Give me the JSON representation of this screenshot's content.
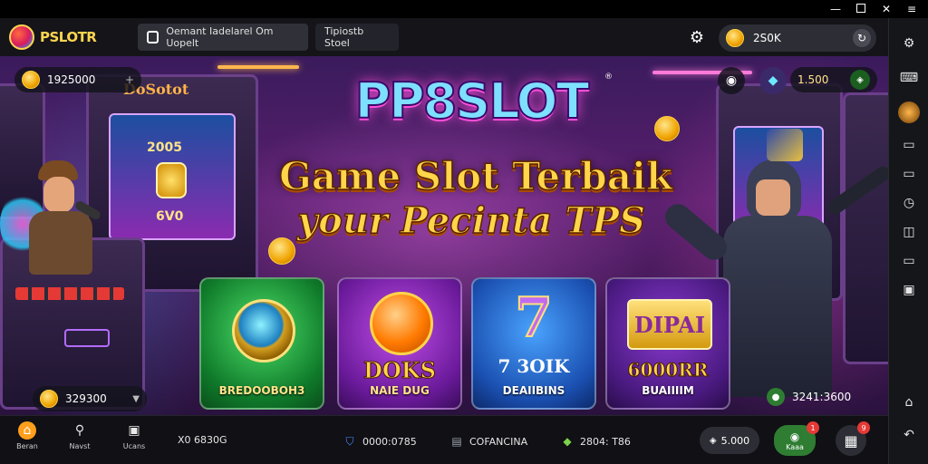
{
  "window": {
    "minimize": "—",
    "restore": "❐",
    "close": "✕"
  },
  "app": {
    "logo_text": "PSLOTR"
  },
  "tabs": [
    {
      "label": "Oemant Iadelarel Om Uopelt"
    },
    {
      "label": "Tipiostb Stoel"
    }
  ],
  "header": {
    "balance": "2S0K"
  },
  "banner": {
    "brand": "PP8SLOT",
    "reg_mark": "®",
    "headline_1": "Game Slot Terbaik",
    "headline_2": "your Pecinta TPS",
    "top_left_chip": "1925000",
    "bottom_left_chip": "329300",
    "right_chip": "1.500",
    "bottom_right_text": "3241:3600",
    "marquee": "DoSotot",
    "left_machine_text": "2005",
    "left_machine_text2": "6V0",
    "cards": [
      {
        "name": "Emerald Shield",
        "big": "",
        "label": "BREDOOBOH3"
      },
      {
        "name": "Orange Orb",
        "big": "DOKS",
        "label": "NAIE DUG"
      },
      {
        "name": "Golden Seven",
        "big": "7 3OIK",
        "label": "DEAIIBINS"
      },
      {
        "name": "Dipai Gold",
        "big": "6000RR",
        "label": "BUAIIIIM"
      }
    ]
  },
  "bottom_nav": {
    "items": [
      {
        "label": "Beran",
        "icon": "home-icon"
      },
      {
        "label": "Navst",
        "icon": "search-icon"
      },
      {
        "label": "Ucans",
        "icon": "bag-icon"
      }
    ],
    "version": "X0 6830G",
    "stat1": "0000:0785",
    "stat2": "COFANCINA",
    "stat3": "2804: T86",
    "pill_amount": "5.000",
    "bet_label": "Kaaa",
    "bet_badge": "1",
    "grid_badge": "9"
  },
  "colors": {
    "accent": "#ff9f1c",
    "gold": "#ffd54a",
    "brand_cyan": "#7ee0ff",
    "bg": "#141419"
  }
}
